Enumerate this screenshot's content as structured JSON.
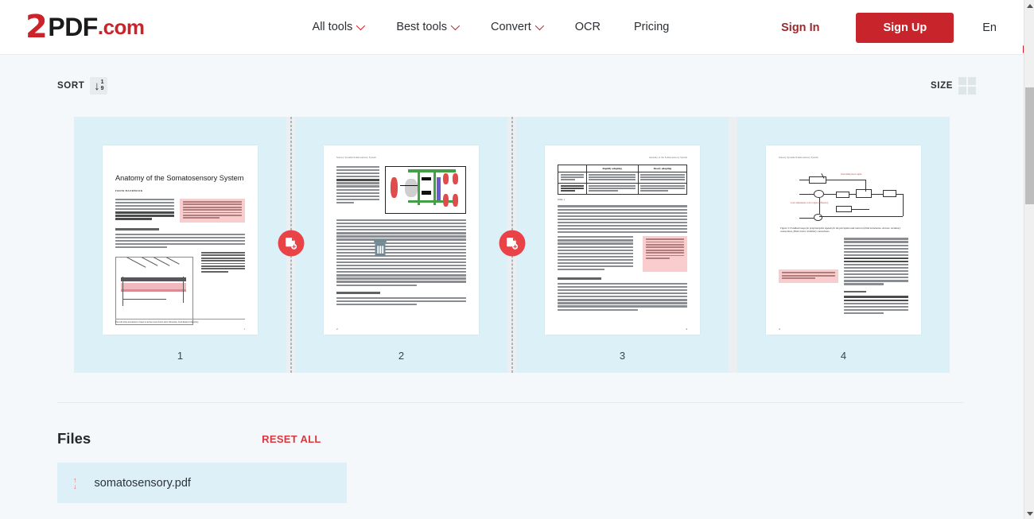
{
  "header": {
    "logo": {
      "two": "2",
      "pdf": "PDF",
      "com": ".com",
      "icon": "document-arrow-logo"
    },
    "nav": [
      {
        "label": "All tools",
        "has_chevron": true
      },
      {
        "label": "Best tools",
        "has_chevron": true
      },
      {
        "label": "Convert",
        "has_chevron": true
      },
      {
        "label": "OCR",
        "has_chevron": false
      },
      {
        "label": "Pricing",
        "has_chevron": false
      }
    ],
    "sign_in": "Sign In",
    "sign_up": "Sign Up",
    "language": "En"
  },
  "toolbar": {
    "sort_label": "SORT",
    "sort_icon": "sort-ascending-icon",
    "sort_icon_top": "1",
    "sort_icon_bottom": "9",
    "size_label": "SIZE",
    "size_icon": "grid-2x2-icon"
  },
  "colors": {
    "brand_red": "#c8242b",
    "insert_red": "#ea4347",
    "tile_blue": "#dcf0f8",
    "page_background": "#f4f8fb",
    "reset_red": "#d6393f",
    "note_pink": "#f9cdcd"
  },
  "insert_buttons": [
    {
      "name": "insert-page-after-1",
      "icon": "document-plus-icon",
      "position": "between-page-1-and-2"
    },
    {
      "name": "insert-page-after-2",
      "icon": "document-plus-icon",
      "position": "between-page-2-and-3"
    }
  ],
  "pages": [
    {
      "number": "1",
      "title": "Anatomy of the Somatosensory System",
      "byline": "FROM HANDBOOK",
      "subheading": "Cutaneous receptors",
      "note": "This is a sample document to showcase page-based formatting. It contains a chapter from a Wikibook called Sensory Systems. None of the content has been changed in this article, but some content has been removed.",
      "figure_caption": "Figure 1: Receptors in the human skin: Mechanoreceptors can be free receptors or encapsulated. Examples for free receptors are the hair receptors at the roots of hairs. Encapsulated receptors are the Pacinian corpuscles and the receptors in the glabrous (hairless) skin: Meissner corpuscles, Ruffini corpuscles and Merkel's disks.",
      "footnote": "The following description is based on lecture notes from Laszlo Zaborszky, from Rutgers University.",
      "folio": "1",
      "figure": "skin-cross-section-diagram",
      "delete_overlay": false
    },
    {
      "number": "2",
      "header_text": "Sensory Systems/Somatosensory System",
      "figure_caption": "Figure 2: Mammalian muscle spindle showing typical position in a muscle (left), neuronal connections in spinal cord (middle) and expanded schematic (right). The spindle is a stretch receptor with its own motor supply consisting of several intrafusal muscle fibres. The sensory endings of a primary group (a) afferent and a secondary group (b) afferent coil around the non-contractile central portions of the intrafusal fibres.",
      "subheading": "Nociceptors",
      "body_tail": "Nociceptors have free nerve endings. Functionally, skin nociceptors are either high threshold mechanoreceptors",
      "folio": "2",
      "figure": "muscle-spindle-diagram",
      "delete_overlay": true,
      "delete_icon": "trash-icon"
    },
    {
      "number": "3",
      "header_text": "Anatomy of the Somatosensory System",
      "table": {
        "columns": [
          "",
          "Rapidly adapting",
          "Slowly adapting"
        ],
        "rows": [
          [
            "Surface receptor / small receptive field",
            "Hair receptor, Meissner's corpuscle: Detect an insect or a very fine vibration. Used for recognizing texture.",
            "Merkel's receptor: Used for spatial details, e.g. a round surface edge or \"an X\" in braille."
          ],
          [
            "Deep receptor / large receptive field",
            "Pacinian corpuscle: \"A diffuse vibration\" e.g. tapping with a pencil.",
            "Ruffini's corpuscle: \"A skin stretch\". Used for joints position and movement."
          ]
        ],
        "label": "Table 1"
      },
      "subheading": "Muscle Spindles",
      "note": "Notice: Tables/figures captions and sidenotes are shown in the sample margin on the left or right depending on whether the page is left or right side; figures are illustrative in the top bottom of the page. Table numbers like the table and Figure 2 of texts onto the sample provided.",
      "folio": "4",
      "delete_overlay": false
    },
    {
      "number": "4",
      "header_text": "Sensory Systems/Somatosensory System",
      "figure_caption": "Figure 3: Feedback loops for proprioceptive signals for the perception and control of limb movements. Arrows: excitatory connections; filled circles: inhibitory connections.",
      "figure_annotations": [
        "Descending motor signal",
        "Load compensates or error signal (difference)"
      ],
      "subheading": "Joint receptors",
      "note": "For more sample tips of how to use \"LaTeX\" and \"TikZ for paper-based publishing see next.pdf",
      "folio": "4",
      "figure": "feedback-loop-block-diagram",
      "delete_overlay": false
    }
  ],
  "files_section": {
    "title": "Files",
    "reset_all": "RESET ALL",
    "items": [
      {
        "name": "somatosensory.pdf",
        "drag_icon": "drag-up-down-icon"
      }
    ]
  },
  "scrollbar": {
    "up_icon": "triangle-up-icon",
    "down_icon": "triangle-down-icon",
    "thumb": "scrollbar-thumb"
  }
}
